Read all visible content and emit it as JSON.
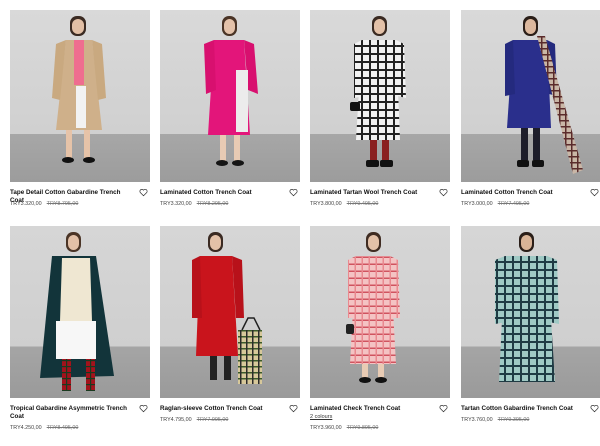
{
  "icons": {
    "favorite": "heart-outline-icon"
  },
  "products": [
    {
      "title": "Tape Detail Cotton Gabardine Trench Coat",
      "price": "TRY3.320,00",
      "old_price": "TRY8.795,00"
    },
    {
      "title": "Laminated Cotton Trench Coat",
      "price": "TRY3.320,00",
      "old_price": "TRY8.295,00"
    },
    {
      "title": "Laminated Tartan Wool Trench Coat",
      "price": "TRY3.800,00",
      "old_price": "TRY9.495,00"
    },
    {
      "title": "Laminated Cotton Trench Coat",
      "price": "TRY3.000,00",
      "old_price": "TRY7.495,00"
    },
    {
      "title": "Tropical Gabardine Asymmetric Trench Coat",
      "price": "TRY4.250,00",
      "old_price": "TRY8.495,00"
    },
    {
      "title": "Raglan-sleeve Cotton Trench Coat",
      "price": "TRY4.795,00",
      "old_price": "TRY7.995,00"
    },
    {
      "title": "Laminated Check Trench Coat",
      "subtitle": "2 colours",
      "price": "TRY3.960,00",
      "old_price": "TRY9.895,00"
    },
    {
      "title": "Tartan Cotton Gabardine Trench Coat",
      "price": "TRY3.760,00",
      "old_price": "TRY9.395,00"
    }
  ]
}
